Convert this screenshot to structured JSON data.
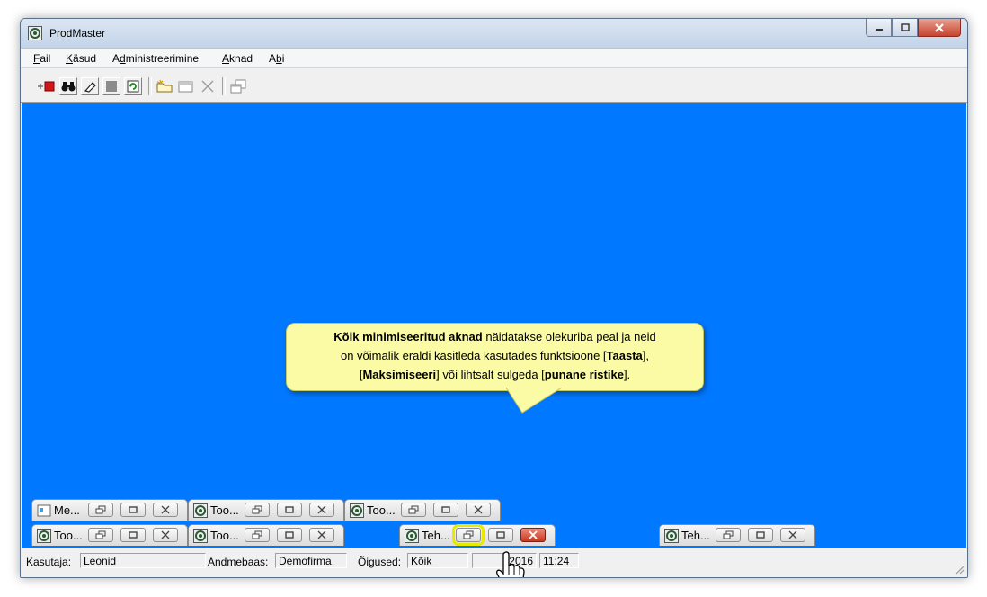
{
  "window": {
    "title": "ProdMaster"
  },
  "menu": [
    {
      "pre": "",
      "u": "F",
      "post": "ail"
    },
    {
      "pre": "",
      "u": "K",
      "post": "äsud"
    },
    {
      "pre": "A",
      "u": "d",
      "post": "ministreerimine"
    },
    {
      "pre": "",
      "u": "A",
      "post": "knad"
    },
    {
      "pre": "A",
      "u": "b",
      "post": "i"
    }
  ],
  "toolbar_icons": [
    "add-record-icon",
    "binoculars-icon",
    "eraser-icon",
    "stop-icon",
    "refresh-icon",
    "new-folder-icon",
    "window-icon",
    "delete-icon",
    "cascade-icon"
  ],
  "callout": {
    "line1_bold": "Kõik minimiseeritud aknad",
    "line1_rest": " näidatakse olekuriba peal ja neid",
    "line2_a": "on võimalik eraldi käsitleda kasutades funktsioone [",
    "line2_bold": "Taasta",
    "line2_b": "],",
    "line3_a": "[",
    "line3_bold1": "Maksimiseeri",
    "line3_b": "] või lihtsalt sulgeda [",
    "line3_bold2": "punane ristike",
    "line3_c": "]."
  },
  "minimized_windows": [
    {
      "title": "Me...",
      "row": 1
    },
    {
      "title": "Too...",
      "row": 1
    },
    {
      "title": "Too...",
      "row": 1
    },
    {
      "title": "Too...",
      "row": 2
    },
    {
      "title": "Too...",
      "row": 2
    },
    {
      "title": "Teh...",
      "row": 2,
      "active": true
    },
    {
      "title": "Teh...",
      "row": 2
    }
  ],
  "status": {
    "user_label": "Kasutaja:",
    "user_value": "Leonid",
    "db_label": "Andmebaas:",
    "db_value": "Demofirma",
    "rights_label": "Õigused:",
    "rights_value": "Kõik",
    "date_value": ".2016",
    "time_value": "11:24"
  },
  "colors": {
    "workspace": "#0078ff",
    "callout": "#fbfba6",
    "close_red": "#c9371f"
  }
}
